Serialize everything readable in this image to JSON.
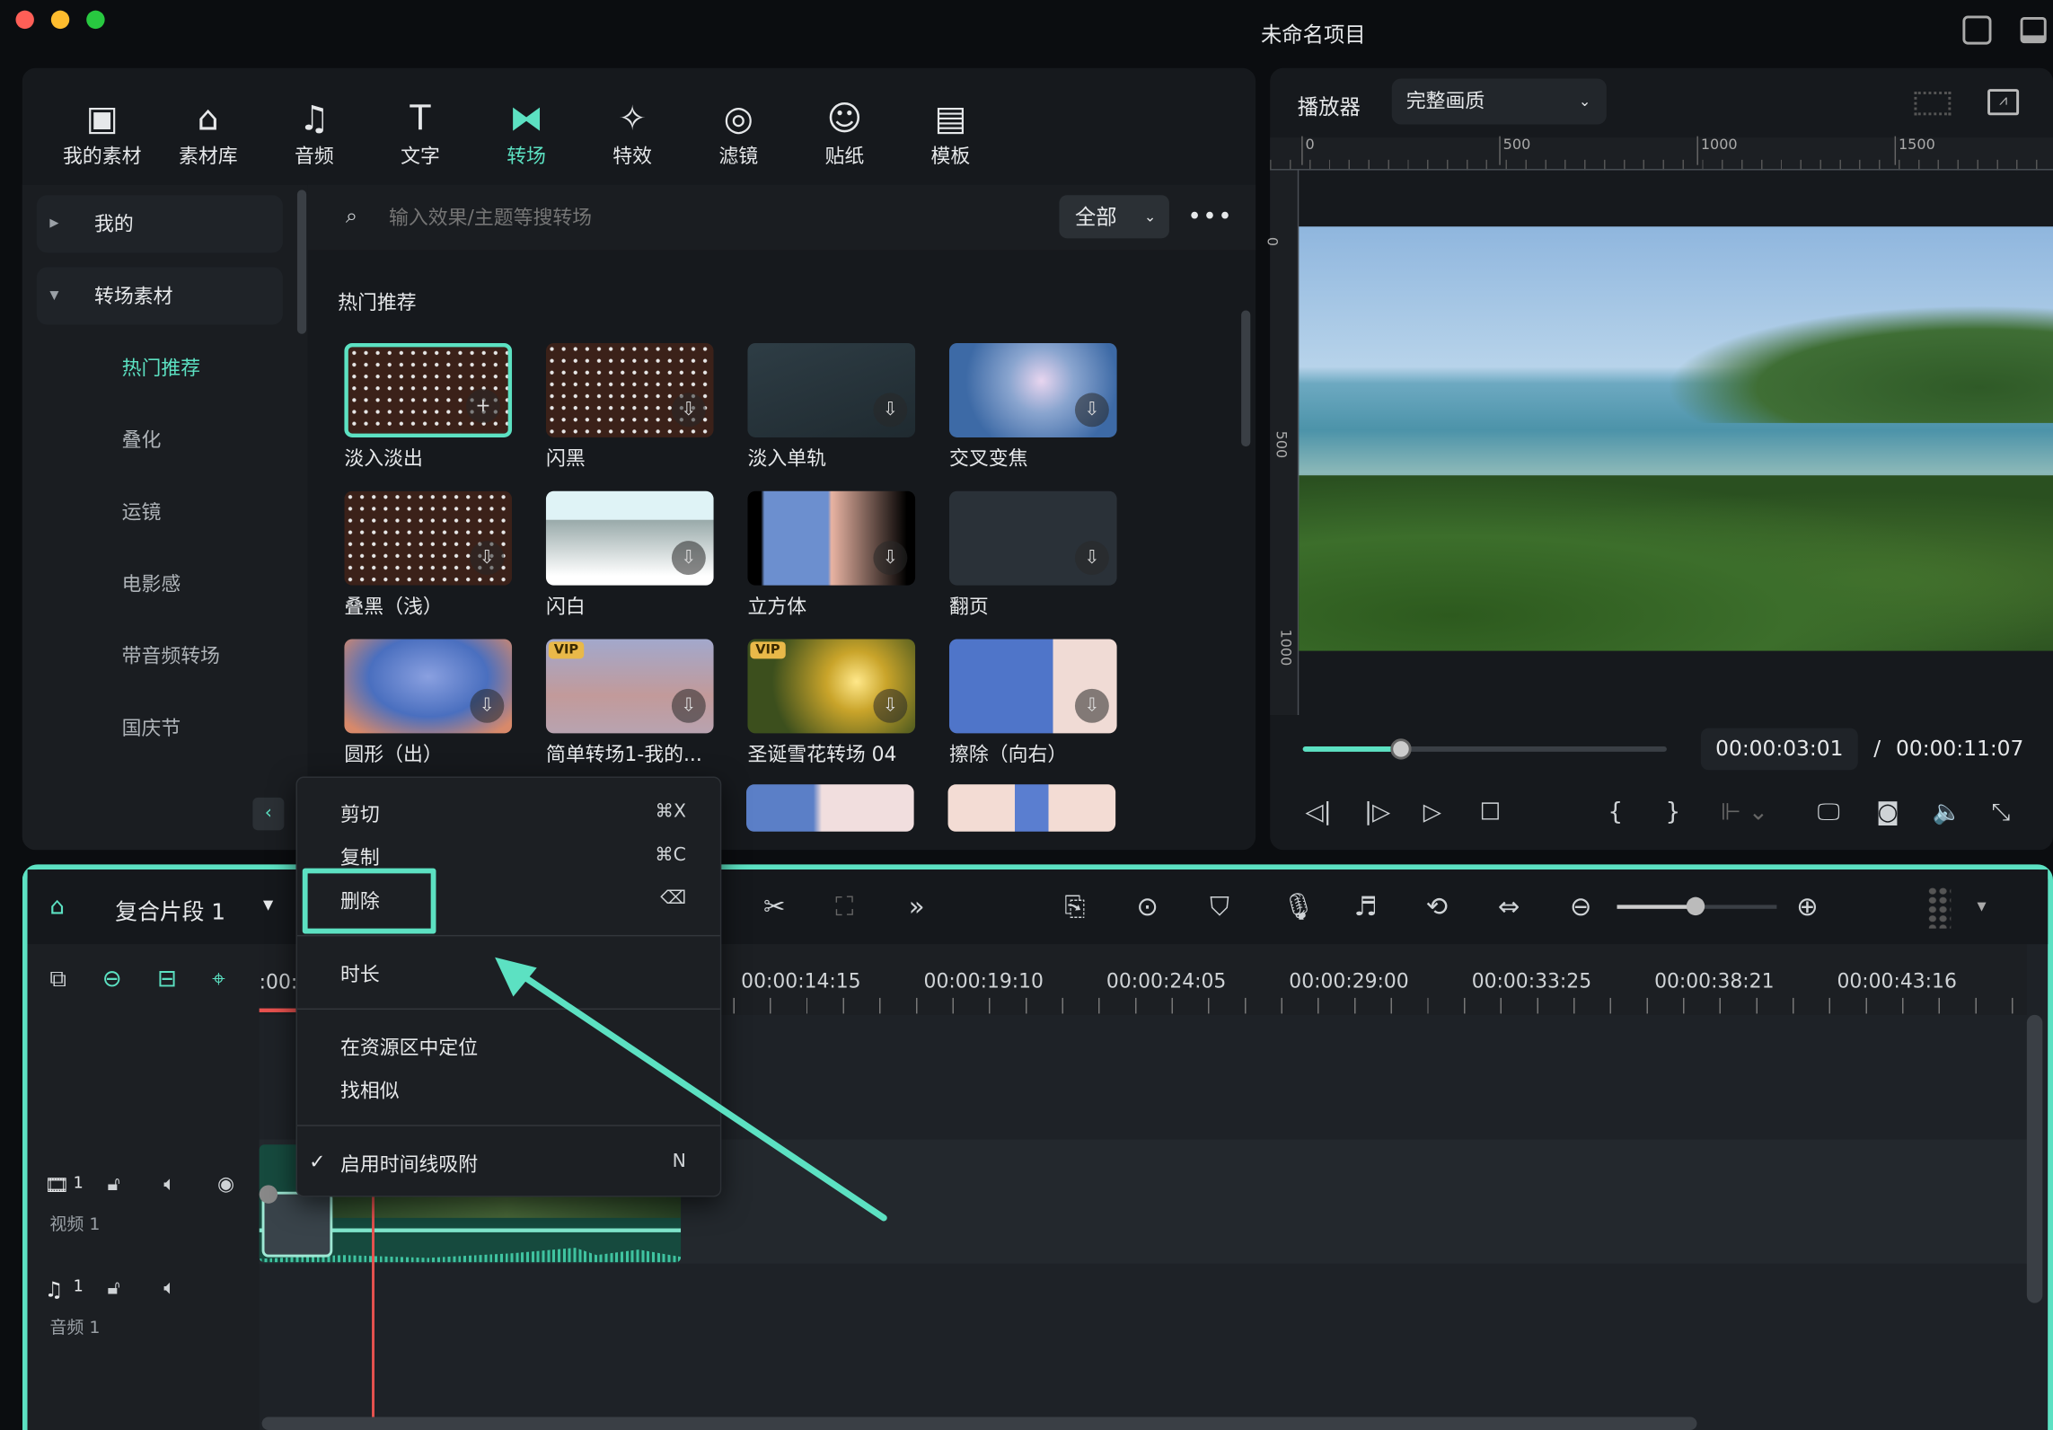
{
  "window": {
    "title": "未命名项目"
  },
  "toolbar": {
    "items": [
      {
        "label": "我的素材",
        "icon": "my-media-icon"
      },
      {
        "label": "素材库",
        "icon": "stock-store-icon"
      },
      {
        "label": "音频",
        "icon": "music-note-icon"
      },
      {
        "label": "文字",
        "icon": "text-icon"
      },
      {
        "label": "转场",
        "icon": "transition-icon",
        "active": true
      },
      {
        "label": "特效",
        "icon": "effects-icon"
      },
      {
        "label": "滤镜",
        "icon": "filter-icon"
      },
      {
        "label": "贴纸",
        "icon": "sticker-icon"
      },
      {
        "label": "模板",
        "icon": "template-icon"
      }
    ]
  },
  "sidebar": {
    "groups": [
      {
        "label": "我的",
        "expanded": false
      },
      {
        "label": "转场素材",
        "expanded": true
      }
    ],
    "subitems": [
      "热门推荐",
      "叠化",
      "运镜",
      "电影感",
      "带音频转场",
      "国庆节"
    ],
    "active": "热门推荐"
  },
  "search": {
    "placeholder": "输入效果/主题等搜转场",
    "filter": "全部"
  },
  "section_title": "热门推荐",
  "transitions": [
    {
      "label": "淡入淡出",
      "selected": true
    },
    {
      "label": "闪黑"
    },
    {
      "label": "淡入单轨"
    },
    {
      "label": "交叉变焦"
    },
    {
      "label": "叠黑（浅）"
    },
    {
      "label": "闪白"
    },
    {
      "label": "立方体"
    },
    {
      "label": "翻页"
    },
    {
      "label": "圆形（出）"
    },
    {
      "label": "简单转场1-我的...",
      "vip": "VIP"
    },
    {
      "label": "圣诞雪花转场 04",
      "vip": "VIP"
    },
    {
      "label": "擦除（向右）"
    }
  ],
  "player": {
    "label": "播放器",
    "quality": "完整画质",
    "ruler_x": [
      "0",
      "500",
      "1000",
      "1500"
    ],
    "ruler_y": [
      "0",
      "500",
      "1000"
    ],
    "current_time": "00:00:03:01",
    "separator": "/",
    "total_time": "00:00:11:07",
    "progress": 0.27
  },
  "context_menu": {
    "items": [
      {
        "label": "剪切",
        "shortcut": "⌘X"
      },
      {
        "label": "复制",
        "shortcut": "⌘C"
      },
      {
        "label": "删除",
        "shortcut": "⌫",
        "highlighted": true
      },
      {
        "label": "时长"
      },
      {
        "label": "在资源区中定位"
      },
      {
        "label": "找相似"
      },
      {
        "label": "启用时间线吸附",
        "shortcut": "N",
        "checked": true
      }
    ]
  },
  "timeline": {
    "clip_name": "复合片段 1",
    "start_partial": ":00:",
    "ticks": [
      "00:00:14:15",
      "00:00:19:10",
      "00:00:24:05",
      "00:00:29:00",
      "00:00:33:25",
      "00:00:38:21",
      "00:00:43:16"
    ],
    "tracks": [
      {
        "num": "1",
        "label": "视频 1"
      },
      {
        "num": "1",
        "label": "音频 1"
      }
    ],
    "zoom": 0.4
  },
  "colors": {
    "accent": "#5ce1c2",
    "playhead": "#e8524f",
    "background": "#0b0d10",
    "panel": "#16191d"
  }
}
